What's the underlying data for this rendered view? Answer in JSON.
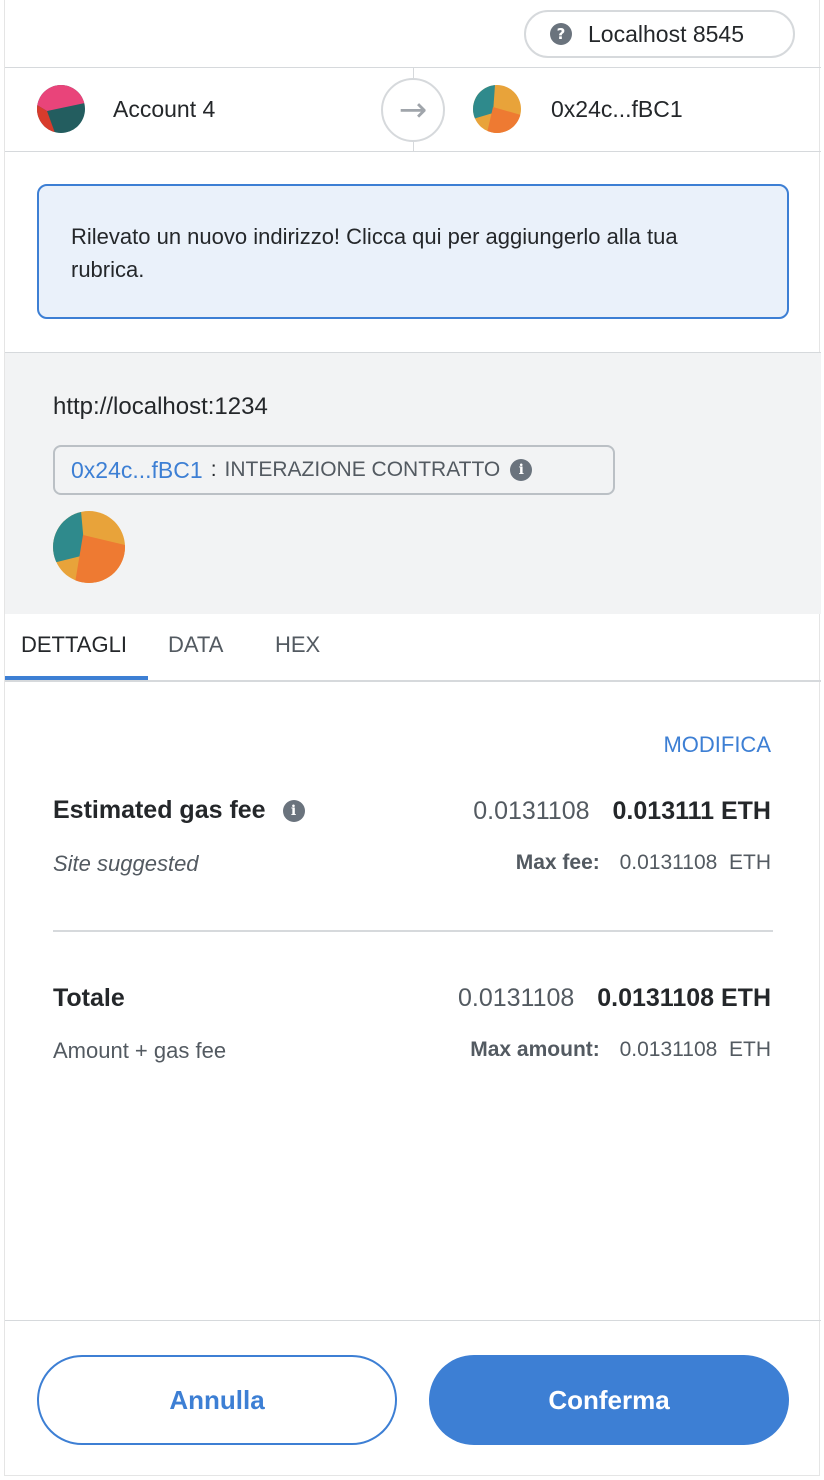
{
  "network": {
    "label": "Localhost 8545",
    "help_icon": "question-circle-icon"
  },
  "accounts": {
    "from_name": "Account 4",
    "to_address": "0x24c...fBC1",
    "arrow_icon": "arrow-right-icon"
  },
  "notice": {
    "text": "Rilevato un nuovo indirizzo! Clicca qui per aggiungerlo alla tua rubrica."
  },
  "origin": {
    "url": "http://localhost:1234",
    "contract_address": "0x24c...fBC1",
    "separator": ":",
    "method": "INTERAZIONE CONTRATTO",
    "info_icon": "info-icon"
  },
  "tabs": [
    {
      "label": "DETTAGLI",
      "active": true
    },
    {
      "label": "DATA",
      "active": false
    },
    {
      "label": "HEX",
      "active": false
    }
  ],
  "details": {
    "edit_label": "MODIFICA",
    "gas": {
      "label": "Estimated gas fee",
      "sub_label": "Site suggested",
      "value_light": "0.0131108",
      "value_bold": "0.013111 ETH",
      "max_label": "Max fee:",
      "max_value": "0.0131108  ETH"
    },
    "total": {
      "label": "Totale",
      "sub_label": "Amount + gas fee",
      "value_light": "0.0131108",
      "value_bold": "0.0131108 ETH",
      "max_label": "Max amount:",
      "max_value": "0.0131108  ETH"
    }
  },
  "footer": {
    "cancel_label": "Annulla",
    "confirm_label": "Conferma"
  },
  "colors": {
    "accent": "#3d7fd4",
    "notice_bg": "#eaf1fa",
    "section_bg": "#f2f3f4"
  }
}
